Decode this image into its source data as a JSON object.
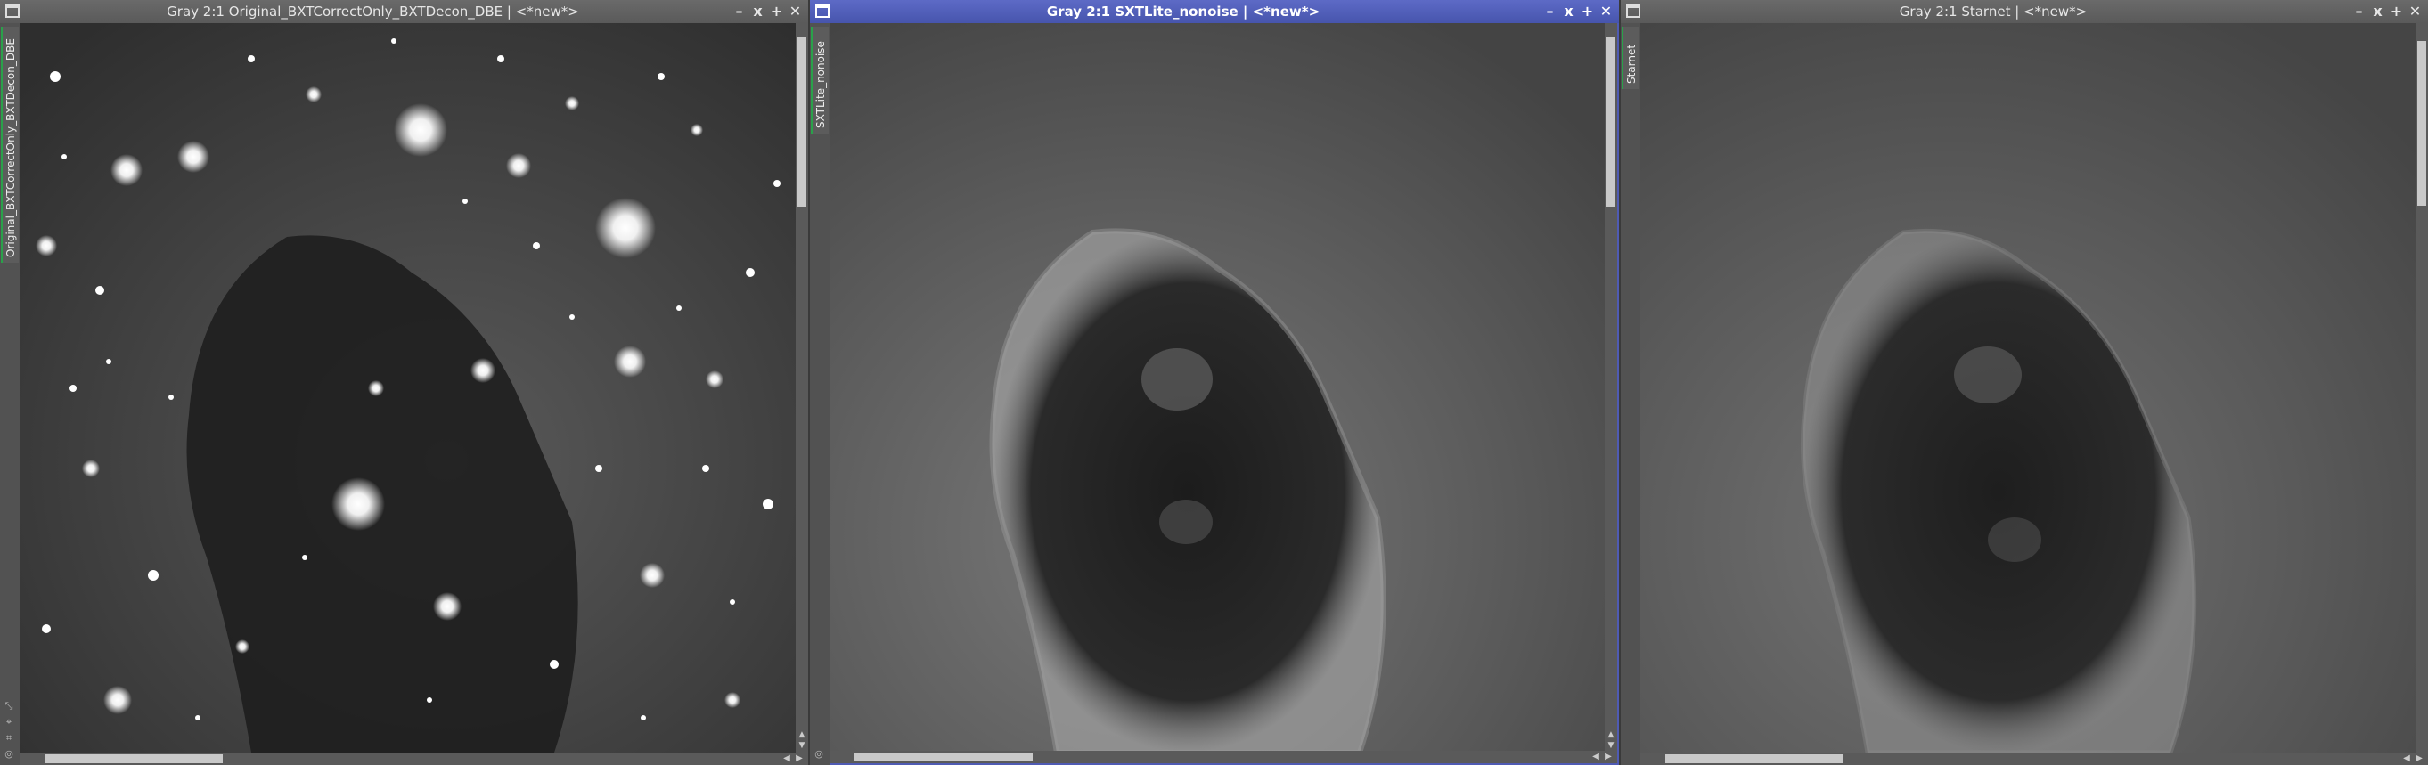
{
  "windows": [
    {
      "title": "Gray 2:1 Original_BXTCorrectOnly_BXTDecon_DBE | <*new*>",
      "sidebar_tab": "Original_BXTCorrectOnly_BXTDecon_DBE",
      "active": false
    },
    {
      "title": "Gray 2:1 SXTLite_nonoise | <*new*>",
      "sidebar_tab": "SXTLite_nonoise",
      "active": true
    },
    {
      "title": "Gray 2:1 Starnet | <*new*>",
      "sidebar_tab": "Starnet",
      "active": false
    }
  ],
  "controls": {
    "minimize": "–",
    "shade": "ⅹ",
    "maximize": "+",
    "close": "✕"
  },
  "icons": [
    "window-icon",
    "minimize-icon",
    "shade-icon",
    "maximize-icon",
    "close-icon",
    "scroll-up-icon",
    "scroll-down-icon",
    "scroll-left-icon",
    "scroll-right-icon"
  ],
  "colors": {
    "active_title": "#4f5bb3",
    "inactive_title": "#5f5f5f",
    "tab_accent": "#2aa14a"
  }
}
